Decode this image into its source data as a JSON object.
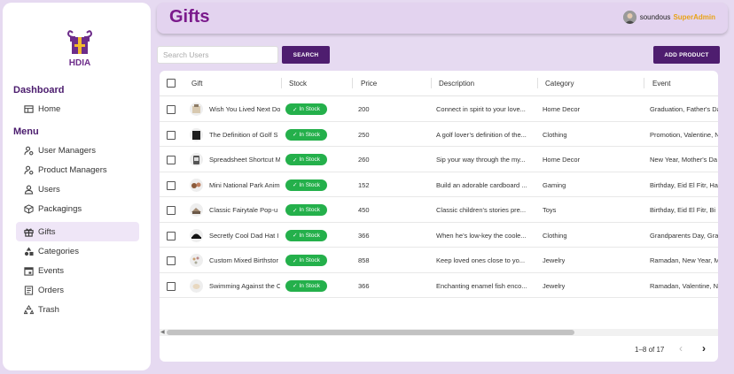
{
  "brand": {
    "name": "HDIA"
  },
  "sidebar": {
    "dashboard_title": "Dashboard",
    "home_label": "Home",
    "menu_title": "Menu",
    "items": [
      {
        "label": "User Managers",
        "icon": "user-gear-icon"
      },
      {
        "label": "Product Managers",
        "icon": "user-gear-icon"
      },
      {
        "label": "Users",
        "icon": "user-icon"
      },
      {
        "label": "Packagings",
        "icon": "box-icon"
      },
      {
        "label": "Gifts",
        "icon": "gift-icon",
        "active": true
      },
      {
        "label": "Categories",
        "icon": "shapes-icon"
      },
      {
        "label": "Events",
        "icon": "calendar-icon"
      },
      {
        "label": "Orders",
        "icon": "list-icon"
      },
      {
        "label": "Trash",
        "icon": "recycle-icon"
      }
    ]
  },
  "header": {
    "title": "Gifts",
    "username": "soundous",
    "role": "SuperAdmin"
  },
  "toolbar": {
    "search_placeholder": "Search Users",
    "search_label": "SEARCH",
    "add_label": "ADD PRODUCT"
  },
  "table": {
    "columns": [
      "Gift",
      "Stock",
      "Price",
      "Description",
      "Category",
      "Event"
    ],
    "rows": [
      {
        "gift": "Wish You Lived Next Do",
        "stock": "In Stock",
        "price": "200",
        "description": "Connect in spirit to your love...",
        "category": "Home Decor",
        "event": "Graduation, Father's Da"
      },
      {
        "gift": "The Definition of Golf S",
        "stock": "In Stock",
        "price": "250",
        "description": "A golf lover’s definition of the...",
        "category": "Clothing",
        "event": "Promotion, Valentine, N"
      },
      {
        "gift": "Spreadsheet Shortcut M",
        "stock": "In Stock",
        "price": "260",
        "description": "Sip your way through the my...",
        "category": "Home Decor",
        "event": "New Year, Mother's Da"
      },
      {
        "gift": "Mini National Park Anim",
        "stock": "In Stock",
        "price": "152",
        "description": "Build an adorable cardboard ...",
        "category": "Gaming",
        "event": "Birthday, Eid El Fitr, Ha"
      },
      {
        "gift": "Classic Fairytale Pop-u",
        "stock": "In Stock",
        "price": "450",
        "description": "Classic children's stories pre...",
        "category": "Toys",
        "event": "Birthday, Eid El Fitr, Bi"
      },
      {
        "gift": "Secretly Cool Dad Hat I",
        "stock": "In Stock",
        "price": "366",
        "description": "When he’s low-key the coole...",
        "category": "Clothing",
        "event": "Grandparents Day, Gra"
      },
      {
        "gift": "Custom Mixed Birthstor",
        "stock": "In Stock",
        "price": "858",
        "description": "Keep loved ones close to yo...",
        "category": "Jewelry",
        "event": "Ramadan, New Year, M"
      },
      {
        "gift": "Swimming Against the C",
        "stock": "In Stock",
        "price": "366",
        "description": "Enchanting enamel fish enco...",
        "category": "Jewelry",
        "event": "Ramadan, Valentine, N"
      }
    ]
  },
  "pagination": {
    "range": "1–8 of 17"
  },
  "colors": {
    "accent": "#4e1d6f",
    "title": "#7b1a8c",
    "stock": "#24b04b",
    "role": "#e8a317",
    "background": "#e6daf1"
  }
}
